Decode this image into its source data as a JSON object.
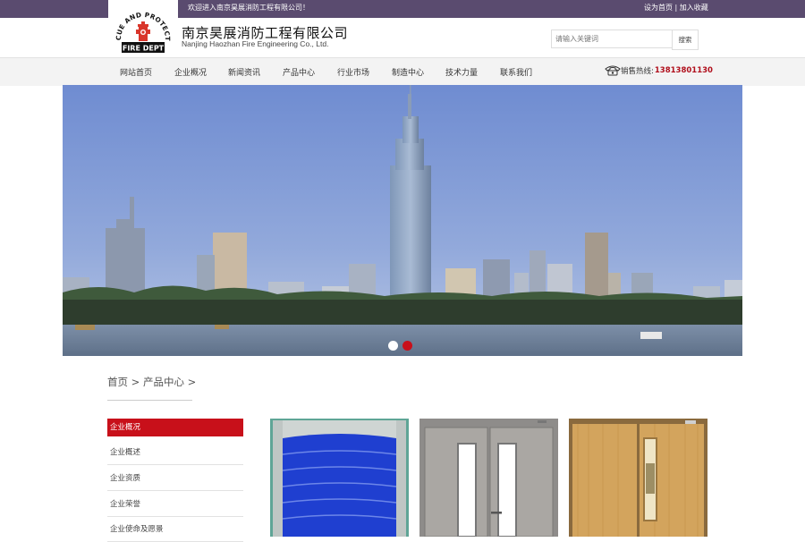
{
  "topbar": {
    "welcome": "欢迎进入南京昊展消防工程有限公司！",
    "set_home": "设为首页",
    "separator": " | ",
    "add_favorite": "加入收藏"
  },
  "header": {
    "logo_top_text": "RESCUE AND PROTECTION",
    "logo_bottom_text": "FIRE DEPT",
    "company_cn": "南京昊展消防工程有限公司",
    "company_en": "Nanjing Haozhan Fire Engineering Co., Ltd.",
    "search_placeholder": "请输入关键词",
    "search_button": "搜索"
  },
  "nav": {
    "items": [
      "网站首页",
      "企业概况",
      "新闻资讯",
      "产品中心",
      "行业市场",
      "制造中心",
      "技术力量",
      "联系我们"
    ],
    "hotline_label": "销售热线:",
    "hotline_number": "13813801130",
    "phone_icon": "phone-icon"
  },
  "banner": {
    "slide_count": 2,
    "active_slide": 2
  },
  "breadcrumb": {
    "home": "首页",
    "sep1": " > ",
    "current": "产品中心",
    "sep2": " >"
  },
  "sidebar": {
    "title": "企业概况",
    "items": [
      "企业概述",
      "企业资质",
      "企业荣誉",
      "企业使命及愿景"
    ]
  },
  "products": {
    "items": [
      "blue-rolling-door",
      "gray-steel-fire-door",
      "wood-fire-door"
    ]
  },
  "colors": {
    "topbar": "#5a4b6f",
    "accent_red": "#c8101a",
    "hotline": "#b00f1c",
    "nav_bg": "#f3f3f3"
  }
}
